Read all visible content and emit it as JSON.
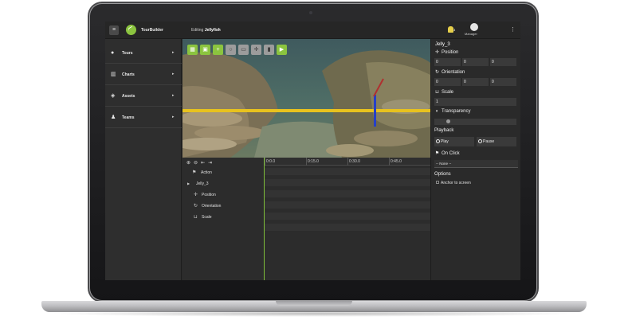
{
  "header": {
    "menu_icon": "menu-icon",
    "app_name": "TourBuilder",
    "editing_prefix": "Editing",
    "editing_item": "Jellyfish",
    "notification_count": "3",
    "user_role": "Manager",
    "more_icon": "kebab-icon",
    "colors": {
      "brand": "#8bc43f",
      "notification": "#e6cf4a"
    }
  },
  "sidebar": {
    "items": [
      {
        "label": "Tours",
        "icon": "circle-icon"
      },
      {
        "label": "Charts",
        "icon": "bar-chart-icon"
      },
      {
        "label": "Assets",
        "icon": "asset-icon"
      },
      {
        "label": "Teams",
        "icon": "team-icon"
      }
    ],
    "arrow": "▸"
  },
  "toolbar": {
    "tools": [
      "layout-icon",
      "save-icon",
      "add-icon",
      "circle-icon",
      "link-icon",
      "move-icon",
      "file-icon",
      "next-icon"
    ]
  },
  "timeline": {
    "ticks": [
      "0:0.0",
      "0:15.0",
      "0:30.0",
      "0:45.0"
    ],
    "rows": [
      {
        "label": "Action",
        "icon": "flag-icon"
      },
      {
        "label": "Jelly_3",
        "icon": "expand-arrow-icon"
      },
      {
        "label": "Position",
        "icon": "move-icon"
      },
      {
        "label": "Orientation",
        "icon": "rotate-icon"
      },
      {
        "label": "Scale",
        "icon": "scale-icon"
      }
    ]
  },
  "properties": {
    "title": "Jelly_3",
    "position": {
      "label": "Position",
      "x": "0",
      "y": "0",
      "z": "0"
    },
    "orientation": {
      "label": "Orientation",
      "x": "0",
      "y": "0",
      "z": "0"
    },
    "scale": {
      "label": "Scale",
      "value": "1"
    },
    "transparency": {
      "label": "Transparency",
      "value": 0.15
    },
    "playback": {
      "label": "Playback",
      "play": "Play",
      "pause": "Pause"
    },
    "on_click": {
      "label": "On Click",
      "selected": "-- None --"
    },
    "options": {
      "label": "Options",
      "anchor_label": "Anchor to screen"
    }
  }
}
